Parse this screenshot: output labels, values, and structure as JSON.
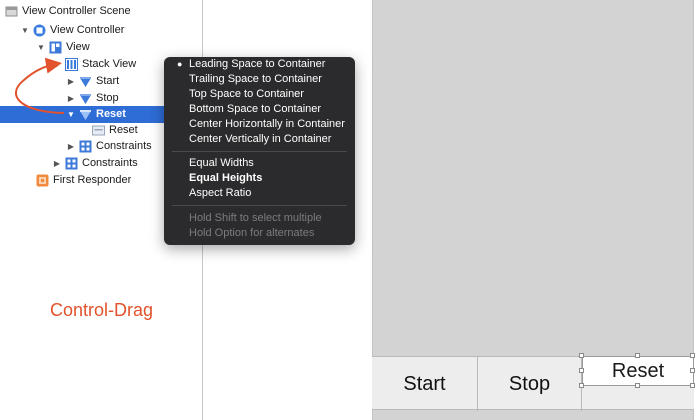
{
  "outline": {
    "items": [
      {
        "label": "View Controller Scene",
        "icon": "scene-icon"
      },
      {
        "label": "View Controller",
        "icon": "view-controller-icon"
      },
      {
        "label": "View",
        "icon": "view-icon"
      },
      {
        "label": "Stack View",
        "icon": "stack-view-icon"
      },
      {
        "label": "Start",
        "icon": "button-icon"
      },
      {
        "label": "Stop",
        "icon": "button-icon"
      },
      {
        "label": "Reset",
        "icon": "button-icon"
      },
      {
        "label": "Reset",
        "icon": "label-icon"
      },
      {
        "label": "Constraints",
        "icon": "constraints-icon"
      },
      {
        "label": "Constraints",
        "icon": "constraints-icon"
      },
      {
        "label": "First Responder",
        "icon": "first-responder-icon"
      }
    ]
  },
  "context_menu": {
    "items": [
      {
        "label": "Leading Space to Container"
      },
      {
        "label": "Trailing Space to Container"
      },
      {
        "label": "Top Space to Container"
      },
      {
        "label": "Bottom Space to Container"
      },
      {
        "label": "Center Horizontally in Container"
      },
      {
        "label": "Center Vertically in Container"
      },
      {
        "label": "Equal Widths"
      },
      {
        "label": "Equal Heights"
      },
      {
        "label": "Aspect Ratio"
      },
      {
        "label": "Hold Shift to select multiple"
      },
      {
        "label": "Hold Option for alternates"
      }
    ]
  },
  "canvas": {
    "buttons": {
      "start": "Start",
      "stop": "Stop",
      "reset": "Reset"
    }
  },
  "annotation": {
    "text": "Control-Drag"
  },
  "colors": {
    "selection": "#2e6cd6",
    "menu_bg": "#2b2b2d",
    "accent_red": "#e24b26"
  }
}
